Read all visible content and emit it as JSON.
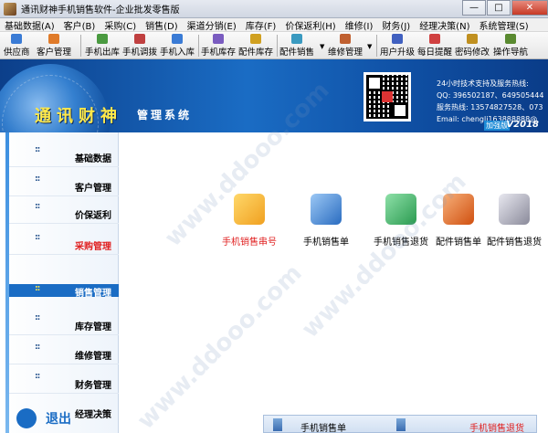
{
  "window": {
    "title": "通讯财神手机销售软件-企业批发零售版",
    "controls": {
      "minimize": "—",
      "maximize": "□",
      "close": "✕"
    }
  },
  "menu": [
    "基础数据(A)",
    "客户(B)",
    "采购(C)",
    "销售(D)",
    "渠道分销(E)",
    "库存(F)",
    "价保返利(H)",
    "维修(I)",
    "财务(J)",
    "经理决策(N)",
    "系统管理(S)"
  ],
  "toolbar": [
    {
      "label": "供应商",
      "icon": "supplier-icon",
      "color": "#3a7bd5"
    },
    {
      "label": "客户管理",
      "icon": "customer-icon",
      "color": "#e07b2a"
    },
    {
      "label": "手机出库",
      "icon": "phone-out-icon",
      "color": "#4a9a40"
    },
    {
      "label": "手机调拨",
      "icon": "phone-transfer-icon",
      "color": "#c04040"
    },
    {
      "label": "手机入库",
      "icon": "phone-in-icon",
      "color": "#3a7bd5"
    },
    {
      "label": "手机库存",
      "icon": "phone-stock-icon",
      "color": "#7a5cc0"
    },
    {
      "label": "配件库存",
      "icon": "parts-stock-icon",
      "color": "#d0a020"
    },
    {
      "label": "配件销售",
      "icon": "parts-sales-icon",
      "color": "#3a9ac0"
    },
    {
      "label": "维修管理",
      "icon": "repair-icon",
      "color": "#c06030"
    },
    {
      "label": "用户升级",
      "icon": "upgrade-icon",
      "color": "#4060c0"
    },
    {
      "label": "每日提醒",
      "icon": "reminder-icon",
      "color": "#d04040"
    },
    {
      "label": "密码修改",
      "icon": "password-icon",
      "color": "#c09020"
    },
    {
      "label": "操作导航",
      "icon": "navigation-icon",
      "color": "#5a8a30"
    }
  ],
  "banner": {
    "brand": "通讯财神",
    "subtitle": "管理系统",
    "contact": [
      "24小时技术支持及服务热线:",
      "QQ: 396502187、649505444",
      "服务热线: 13574827528、073",
      "Email: chengli163888888@"
    ],
    "edition": "加强版",
    "version": "V2018"
  },
  "sidebar": [
    {
      "label": "基础数据",
      "dots": "::",
      "style": "normal"
    },
    {
      "label": "客户管理",
      "dots": "::",
      "style": "normal"
    },
    {
      "label": "价保返利",
      "dots": "::",
      "style": "normal"
    },
    {
      "label": "采购管理",
      "dots": "::",
      "style": "red"
    },
    {
      "label": "销售管理",
      "dots": "::",
      "style": "active"
    },
    {
      "label": "库存管理",
      "dots": "::",
      "style": "normal"
    },
    {
      "label": "维修管理",
      "dots": "::",
      "style": "normal"
    },
    {
      "label": "财务管理",
      "dots": "::",
      "style": "normal"
    },
    {
      "label": "经理决策",
      "dots": "",
      "style": "normal"
    }
  ],
  "exit_label": "退出",
  "functions": [
    {
      "label": "手机销售串号",
      "icon": "folder-icon",
      "color": "#f0b030",
      "red": true
    },
    {
      "label": "手机销售单",
      "icon": "document-icon",
      "color": "#3a7bd5",
      "red": false
    },
    {
      "label": "手机销售退货",
      "icon": "return-icon",
      "color": "#2a9a50",
      "red": false
    },
    {
      "label": "配件销售单",
      "icon": "parts-order-icon",
      "color": "#d06020",
      "red": false
    },
    {
      "label": "配件销售退货",
      "icon": "printer-icon",
      "color": "#8a8a9a",
      "red": false
    }
  ],
  "bottom_panel": {
    "left": "手机销售单",
    "right": "手机销售退货"
  },
  "watermark": "www.ddooo.com"
}
